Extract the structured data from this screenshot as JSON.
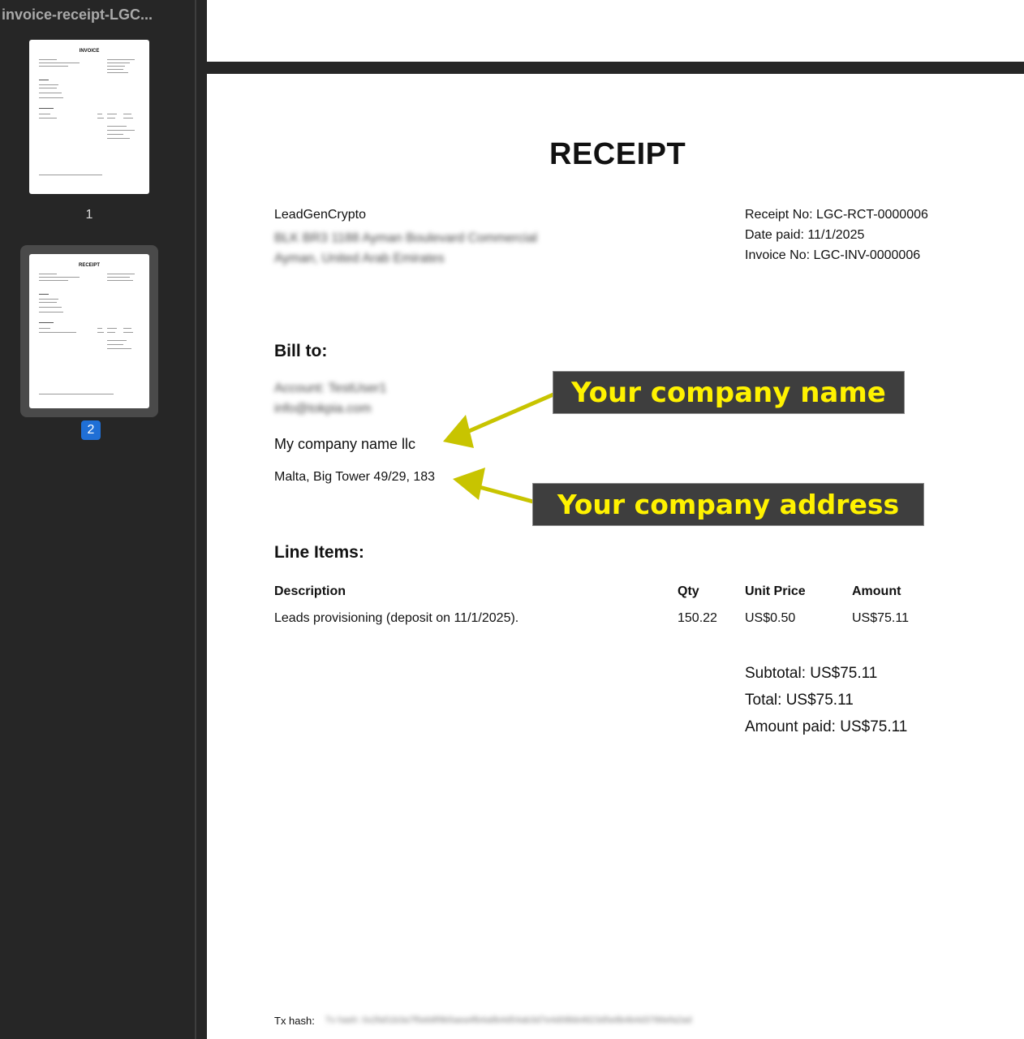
{
  "sidebar": {
    "document_title": "invoice-receipt-LGC...",
    "thumbnails": [
      {
        "page_label": "1",
        "thumb_heading": "INVOICE",
        "selected": false
      },
      {
        "page_label": "2",
        "thumb_heading": "RECEIPT",
        "selected": true
      }
    ]
  },
  "receipt": {
    "title": "RECEIPT",
    "seller": {
      "name": "LeadGenCrypto",
      "address_line1": "BLK BR3 1188 Ayman Boulevard Commercial",
      "address_line2": "Ayman, United Arab Emirates"
    },
    "meta": {
      "receipt_no": "Receipt No: LGC-RCT-0000006",
      "date_paid": "Date paid: 11/1/2025",
      "invoice_no": "Invoice No: LGC-INV-0000006"
    },
    "bill_to": {
      "heading": "Bill to:",
      "account": "Account: TestUser1",
      "email": "info@tokpia.com",
      "company": "My company name llc",
      "address": "Malta, Big Tower 49/29, 183"
    },
    "line_items": {
      "heading": "Line Items:",
      "columns": [
        "Description",
        "Qty",
        "Unit Price",
        "Amount"
      ],
      "rows": [
        [
          "Leads provisioning (deposit on 11/1/2025).",
          "150.22",
          "US$0.50",
          "US$75.11"
        ]
      ]
    },
    "totals": {
      "subtotal": "Subtotal: US$75.11",
      "total": "Total: US$75.11",
      "amount_paid": "Amount paid: US$75.11"
    },
    "tx_hash_label": "Tx hash:",
    "tx_hash_value": "Tx hash: 0x2fa51b3a7f5eb8f9b5aea4fb4a8b4d54ab3d7e4d08bb4823d5e8b4b4d3786efa2ad"
  },
  "annotations": {
    "company_name_callout": "Your company name",
    "company_address_callout": "Your company address",
    "highlight_color": "#fff200",
    "arrow_color": "#c8c400"
  }
}
